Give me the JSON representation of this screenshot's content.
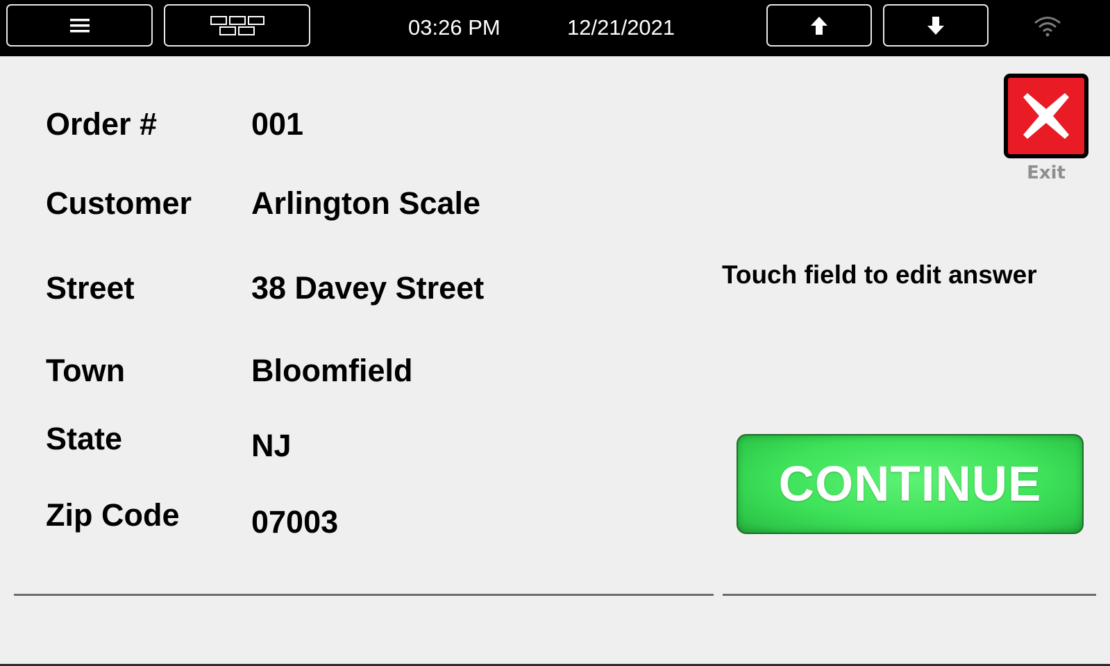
{
  "topbar": {
    "time": "03:26 PM",
    "date": "12/21/2021",
    "icons": {
      "menu": "hamburger-menu-icon",
      "grid": "tile-grid-icon",
      "up": "arrow-up-icon",
      "down": "arrow-down-icon",
      "wifi": "wifi-icon"
    }
  },
  "form": {
    "fields": [
      {
        "label": "Order #",
        "value": "001"
      },
      {
        "label": "Customer",
        "value": "Arlington Scale"
      },
      {
        "label": "Street",
        "value": "38 Davey Street"
      },
      {
        "label": "Town",
        "value": "Bloomfield"
      },
      {
        "label": "State",
        "value": "NJ"
      },
      {
        "label": "Zip Code",
        "value": "07003"
      }
    ]
  },
  "exit": {
    "label": "Exit",
    "color": "#e91b25"
  },
  "hint": "Touch field to edit answer",
  "continue": {
    "label": "CONTINUE",
    "color": "#3ee259"
  }
}
